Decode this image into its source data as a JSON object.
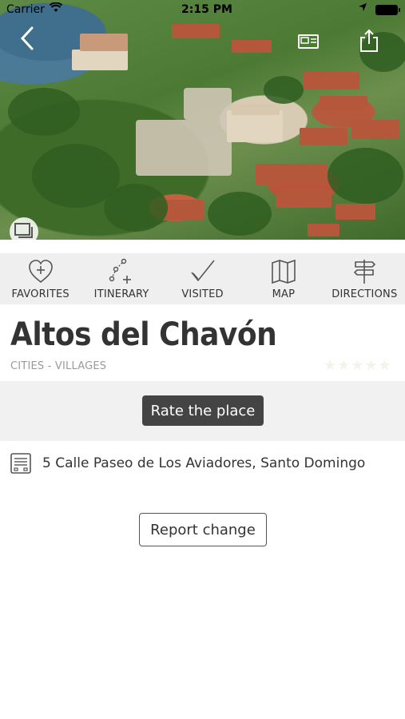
{
  "status_bar": {
    "carrier": "Carrier",
    "wifi_icon": "wifi-icon",
    "time": "2:15 PM",
    "location_icon": "location-arrow-icon",
    "battery_icon": "battery-icon"
  },
  "hero": {
    "back_icon": "chevron-left-icon",
    "gallery_icon": "postcard-icon",
    "share_icon": "share-icon",
    "photos_icon": "photos-stack-icon"
  },
  "actions": [
    {
      "label": "FAVORITES",
      "icon": "heart-plus-icon"
    },
    {
      "label": "ITINERARY",
      "icon": "route-plus-icon"
    },
    {
      "label": "VISITED",
      "icon": "checkmark-icon"
    },
    {
      "label": "MAP",
      "icon": "map-icon"
    },
    {
      "label": "DIRECTIONS",
      "icon": "signpost-icon"
    }
  ],
  "place": {
    "name": "Altos del Chavón",
    "category": "CITIES - VILLAGES",
    "rating_stars": "★★★★★"
  },
  "rate_button": "Rate the place",
  "address": {
    "icon": "address-card-icon",
    "text": "5 Calle Paseo de Los Aviadores, Santo Domingo"
  },
  "report_button": "Report change",
  "colors": {
    "action_bar_bg": "#efefef",
    "rate_button_bg": "#444444",
    "text_primary": "#333333",
    "text_secondary": "#9a9a9a"
  }
}
